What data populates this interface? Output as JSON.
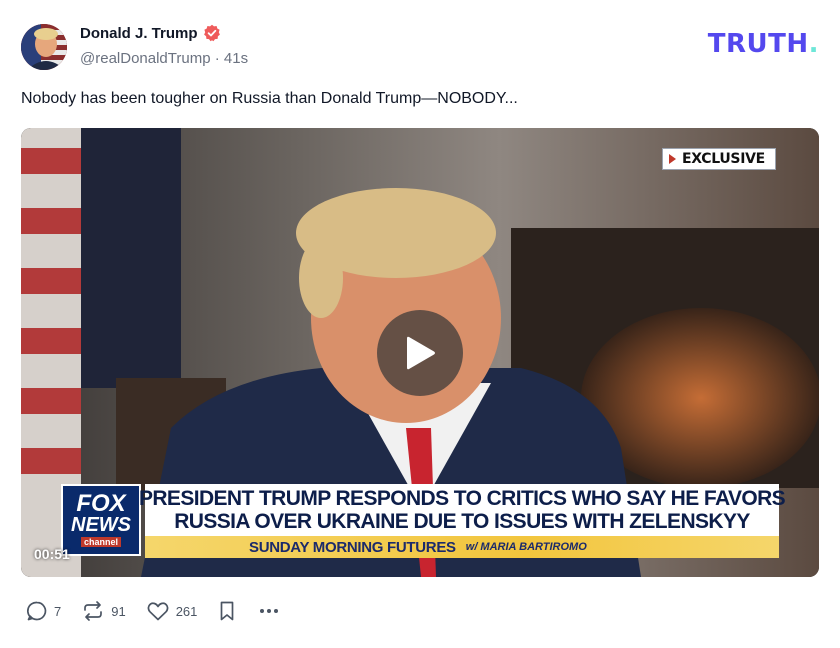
{
  "post": {
    "author_name": "Donald J. Trump",
    "author_handle": "@realDonaldTrump",
    "separator": "·",
    "time_ago": "41s",
    "text": "Nobody has been tougher on Russia than Donald Trump—NOBODY..."
  },
  "brand": {
    "logo_text": "TRUTH",
    "logo_dot": ".",
    "logo_color": "#5448ee",
    "dot_color": "#6ee7d8"
  },
  "video": {
    "duration": "00:51",
    "badge": "EXCLUSIVE",
    "network_logo_line1": "FOX",
    "network_logo_line2": "NEWS",
    "network_logo_line3": "channel",
    "headline_line1": "PRESIDENT TRUMP RESPONDS TO CRITICS WHO SAY HE FAVORS",
    "headline_line2": "RUSSIA OVER UKRAINE DUE TO ISSUES WITH ZELENSKYY",
    "show_name": "SUNDAY MORNING FUTURES",
    "host": "w/ MARIA BARTIROMO"
  },
  "actions": {
    "replies": "7",
    "retruths": "91",
    "likes": "261"
  },
  "icons": [
    "verified-icon",
    "reply-icon",
    "retruth-icon",
    "like-icon",
    "bookmark-icon",
    "more-icon",
    "play-icon"
  ]
}
